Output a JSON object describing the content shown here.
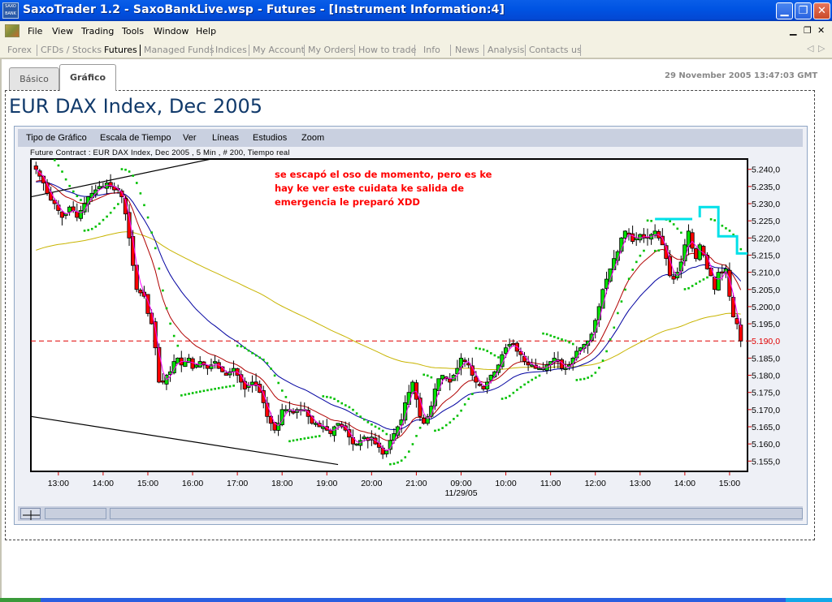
{
  "window": {
    "title": "SaxoTrader 1.2 - SaxoBankLive.wsp - Futures - [Instrument Information:4]",
    "logo_text": "SAXO BANK",
    "minimize": "_",
    "restore": "❐",
    "close": "✕"
  },
  "menu": {
    "items": [
      "File",
      "View",
      "Trading",
      "Tools",
      "Window",
      "Help"
    ],
    "mdi_controls": [
      "_",
      "🗗",
      "✕"
    ]
  },
  "nav": {
    "items": [
      "Forex",
      "CFDs / Stocks",
      "Futures",
      "Managed Funds",
      "Indices",
      "My Account",
      "My Orders",
      "How to trade",
      "Info",
      "News",
      "Analysis",
      "Contacts us"
    ],
    "active": "Futures",
    "arrow_left": "◁",
    "arrow_right": "▷"
  },
  "tabs": [
    {
      "label": "Básico",
      "active": false
    },
    {
      "label": "Gráfico",
      "active": true
    }
  ],
  "timestamp": "29 November 2005 13:47:03 GMT",
  "page_title": "EUR DAX Index, Dec 2005",
  "chart_menu": [
    "Tipo de Gráfico",
    "Escala de Tiempo",
    "Ver",
    "Líneas",
    "Estudios",
    "Zoom"
  ],
  "chart_info": "Future Contract : EUR DAX Index, Dec 2005 , 5 Min , # 200, Tiempo real",
  "annotation": [
    "se escapó el oso de momento, pero es ke",
    "hay ke ver este cuidata ke salida de",
    "emergencia le preparó XDD"
  ],
  "colors": {
    "up_candle": "#00e000",
    "down_candle": "#ff0000",
    "sma_fast": "#ff00ff",
    "sma_mid": "#b00000",
    "sma_slow": "#0000a0",
    "sma_long": "#c8b400",
    "parabolic_sar": "#00c000",
    "last_price_line": "#e00000",
    "annotation_lines": "#00e0e8",
    "trendlines": "#000000"
  },
  "chart_data": {
    "type": "candlestick",
    "title": "Future Contract : EUR DAX Index, Dec 2005 , 5 Min , # 200, Tiempo real",
    "xlabel": "",
    "ylabel": "",
    "ylim": [
      5152,
      5243
    ],
    "y_ticks": [
      5240,
      5235,
      5230,
      5225,
      5220,
      5215,
      5210,
      5205,
      5200,
      5195,
      5190,
      5185,
      5180,
      5175,
      5170,
      5165,
      5160,
      5155
    ],
    "y_tick_labels": [
      "5.240,0",
      "5.235,0",
      "5.230,0",
      "5.225,0",
      "5.220,0",
      "5.215,0",
      "5.210,0",
      "5.205,0",
      "5.200,0",
      "5.195,0",
      "5.190,0",
      "5.185,0",
      "5.180,0",
      "5.175,0",
      "5.170,0",
      "5.165,0",
      "5.160,0",
      "5.155,0"
    ],
    "x_ticks": [
      "13:00",
      "14:00",
      "15:00",
      "16:00",
      "17:00",
      "18:00",
      "19:00",
      "20:00",
      "21:00",
      "09:00",
      "10:00",
      "11:00",
      "12:00",
      "13:00",
      "14:00",
      "15:00"
    ],
    "x_tick_bar_index": [
      6,
      18,
      30,
      42,
      54,
      66,
      78,
      90,
      102,
      114,
      126,
      138,
      150,
      162,
      174,
      186
    ],
    "date_label": "11/29/05",
    "date_label_under": "09:00",
    "last_price": 5190.0,
    "last_price_label": "5.190,0",
    "grid": false,
    "legend": "none",
    "close_path": [
      5240,
      5238,
      5236,
      5233,
      5231,
      5230,
      5228,
      5226,
      5227,
      5229,
      5228,
      5226,
      5228,
      5230,
      5232,
      5233,
      5234,
      5235,
      5235,
      5236,
      5235,
      5234,
      5234,
      5232,
      5227,
      5220,
      5212,
      5205,
      5204,
      5203,
      5198,
      5195,
      5188,
      5178,
      5178,
      5180,
      5181,
      5184,
      5185,
      5183,
      5184,
      5185,
      5182,
      5183,
      5184,
      5183,
      5182,
      5183,
      5184,
      5182,
      5181,
      5180,
      5181,
      5182,
      5180,
      5178,
      5176,
      5177,
      5178,
      5177,
      5175,
      5172,
      5168,
      5166,
      5164,
      5166,
      5170,
      5170,
      5170,
      5169,
      5170,
      5170,
      5170,
      5168,
      5166,
      5166,
      5165,
      5165,
      5164,
      5163,
      5165,
      5166,
      5165,
      5164,
      5162,
      5160,
      5160,
      5161,
      5162,
      5161,
      5162,
      5160,
      5159,
      5157,
      5158,
      5161,
      5163,
      5165,
      5167,
      5172,
      5175,
      5178,
      5173,
      5168,
      5166,
      5168,
      5171,
      5176,
      5179,
      5180,
      5179,
      5178,
      5180,
      5182,
      5185,
      5184,
      5183,
      5180,
      5178,
      5177,
      5176,
      5178,
      5180,
      5181,
      5183,
      5186,
      5188,
      5189,
      5189,
      5187,
      5186,
      5184,
      5183,
      5183,
      5182,
      5182,
      5182,
      5183,
      5184,
      5185,
      5184,
      5182,
      5182,
      5183,
      5185,
      5187,
      5188,
      5189,
      5190,
      5192,
      5196,
      5200,
      5205,
      5208,
      5211,
      5214,
      5216,
      5220,
      5222,
      5221,
      5219,
      5220,
      5221,
      5220,
      5220,
      5221,
      5222,
      5220,
      5218,
      5214,
      5209,
      5208,
      5210,
      5213,
      5218,
      5222,
      5217,
      5214,
      5218,
      5215,
      5211,
      5209,
      5205,
      5210,
      5210,
      5211,
      5203,
      5197,
      5195,
      5190
    ],
    "indicators": [
      "SMA fast",
      "SMA medium",
      "SMA slow",
      "SMA long",
      "Parabolic SAR"
    ],
    "trendlines": [
      {
        "from": [
          0,
          5232
        ],
        "to": [
          47,
          5243
        ]
      },
      {
        "from": [
          0,
          5168
        ],
        "to": [
          81,
          5154
        ]
      }
    ]
  },
  "status_bar": {
    "crosshair_icon": "crosshair-icon"
  }
}
